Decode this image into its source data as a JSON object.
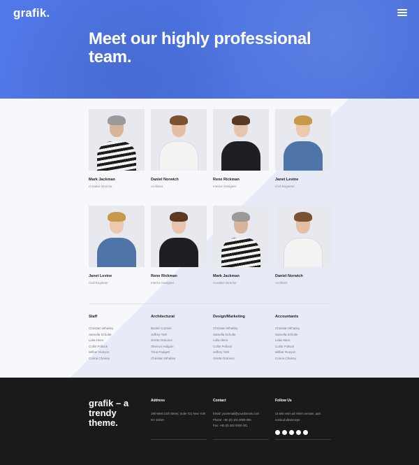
{
  "header": {
    "logo": "grafik.",
    "title": "Meet our highly professional team."
  },
  "team": [
    {
      "name": "Mark Jackman",
      "role": "Creative Director"
    },
    {
      "name": "Daniel Norwich",
      "role": "Architect"
    },
    {
      "name": "Rene Rickman",
      "role": "Interior Designer"
    },
    {
      "name": "Janet Levine",
      "role": "Civil Engineer"
    },
    {
      "name": "Janet Levine",
      "role": "Civil Engineer"
    },
    {
      "name": "Rene Rickman",
      "role": "Interior Designer"
    },
    {
      "name": "Mark Jackman",
      "role": "Creative Director"
    },
    {
      "name": "Daniel Norwich",
      "role": "Architect"
    }
  ],
  "departments": [
    {
      "title": "Staff",
      "members": [
        "Christian Whatley",
        "Samella Schulte",
        "Lidia Hiers",
        "Collin Pollock",
        "Wilber Runyon",
        "Corina Chaney"
      ]
    },
    {
      "title": "Architectural",
      "members": [
        "Buster Cornish",
        "Jeffrey Toth",
        "Gretta Ordonez",
        "Sherron Hulguin",
        "Trina Padgett",
        "Christian Whatley"
      ]
    },
    {
      "title": "Design/Marketing",
      "members": [
        "Christian Whatley",
        "Samella Schulte",
        "Lidia Hiers",
        "Collin Pollock",
        "Jeffrey Toth",
        "Gretta Ordonez"
      ]
    },
    {
      "title": "Accountants",
      "members": [
        "Christian Whatley",
        "Samella Schulte",
        "Lidia Hiers",
        "Collin Pollock",
        "Wilber Runyon",
        "Corina Chaney"
      ]
    }
  ],
  "footer": {
    "tagline": "grafik – a trendy theme.",
    "address": {
      "title": "Address",
      "text": "190 West 21th Street, Suite 721 New York NY 10010"
    },
    "contact": {
      "title": "Contact",
      "email": "Email: youremail@yourdomain.com",
      "phone": "Phone: +80 (0) 101 0000 000",
      "fax": "Fax: +80 (0) 202 0000 001"
    },
    "follow": {
      "title": "Follow Us",
      "text": "Ut wisi enim ad minim veniam, quis nostrud ullamcorpe",
      "icons": [
        "facebook-icon",
        "twitter-icon",
        "dribbble-icon",
        "instagram-icon",
        "vimeo-icon"
      ]
    }
  },
  "colors": {
    "brand_blue": "#4a73e6",
    "footer_bg": "#1a1a1a"
  }
}
